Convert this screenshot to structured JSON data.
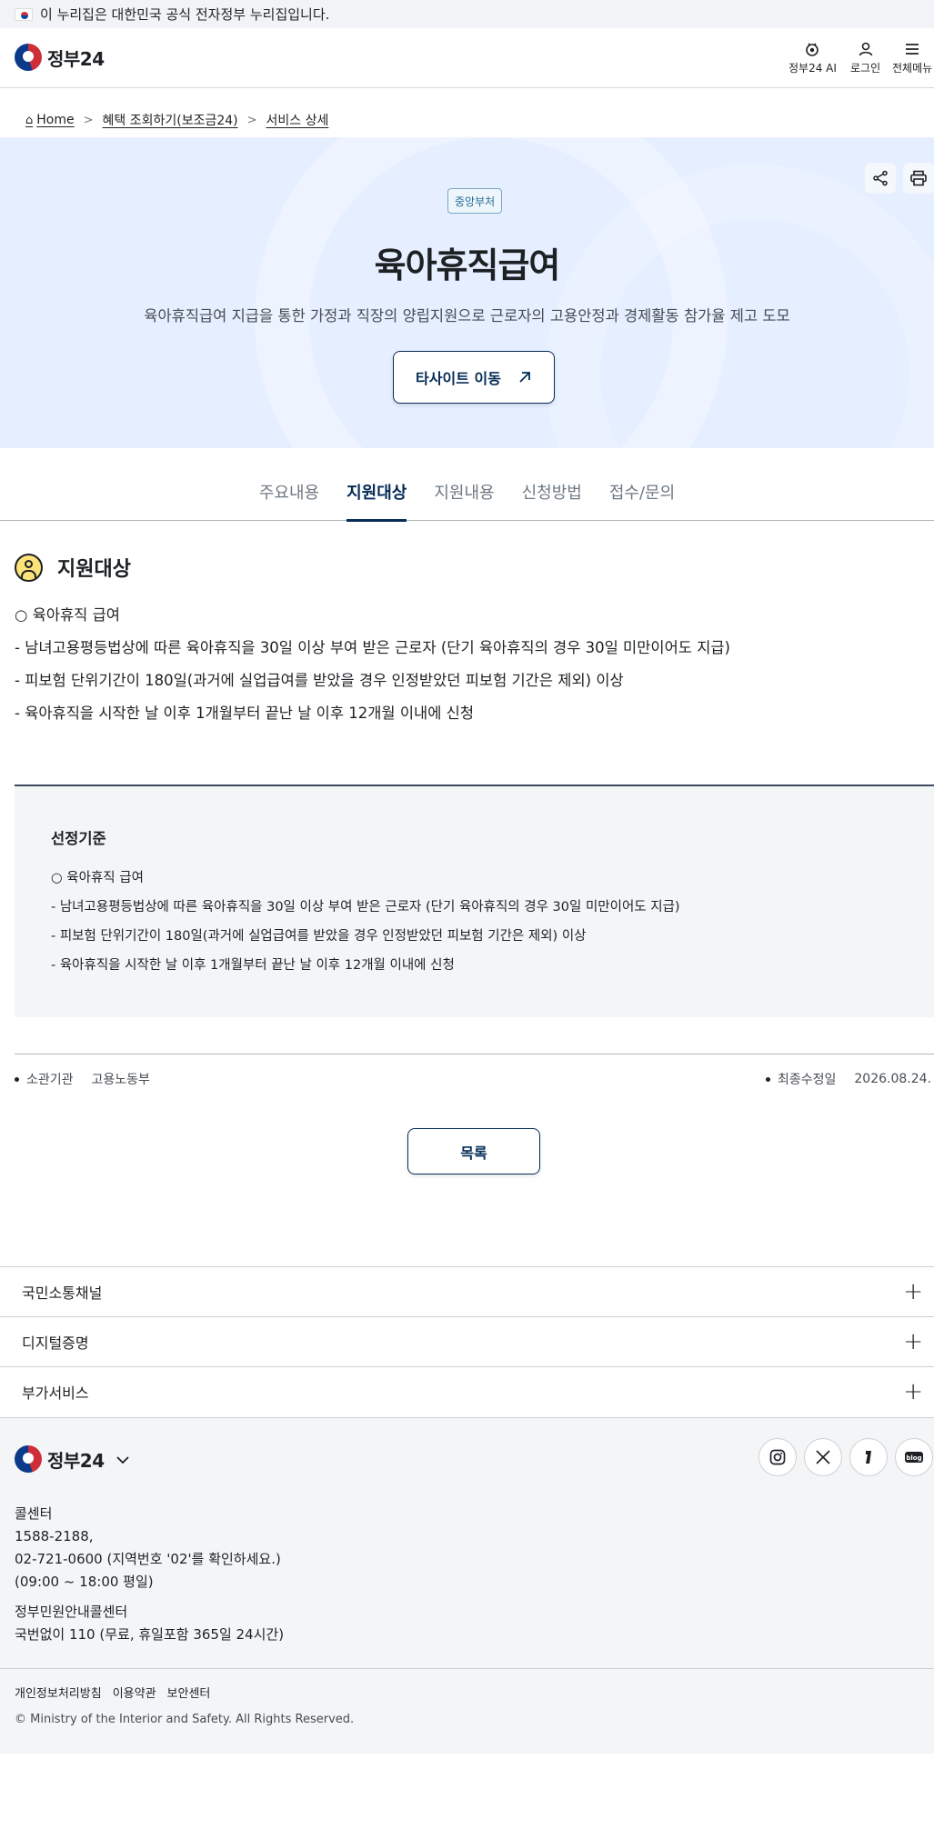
{
  "notice": {
    "text": "이 누리집은 대한민국 공식 전자정부 누리집입니다."
  },
  "header": {
    "logo_text": "정부24",
    "ai_label": "정부24 AI",
    "login_label": "로그인",
    "menu_label": "전체메뉴"
  },
  "breadcrumb": [
    "Home",
    "혜택 조회하기(보조금24)",
    "서비스 상세"
  ],
  "hero": {
    "badge": "중앙부처",
    "title": "육아휴직급여",
    "description": "육아휴직급여 지급을 통한 가정과 직장의 양립지원으로 근로자의 고용안정과 경제활동 참가율 제고 도모",
    "external_button": "타사이트 이동"
  },
  "tabs": [
    {
      "label": "주요내용",
      "active": false
    },
    {
      "label": "지원대상",
      "active": true
    },
    {
      "label": "지원내용",
      "active": false
    },
    {
      "label": "신청방법",
      "active": false
    },
    {
      "label": "접수/문의",
      "active": false
    }
  ],
  "section": {
    "title": "지원대상",
    "lines": [
      "○ 육아휴직 급여",
      "- 남녀고용평등법상에 따른 육아휴직을 30일 이상 부여 받은 근로자 (단기 육아휴직의 경우 30일 미만이어도 지급)",
      "- 피보험 단위기간이 180일(과거에 실업급여를 받았을 경우 인정받았던 피보험 기간은 제외) 이상",
      "- 육아휴직을 시작한 날 이후 1개월부터 끝난 날 이후 12개월 이내에 신청"
    ]
  },
  "selection": {
    "title": "선정기준",
    "lines": [
      "○ 육아휴직 급여",
      "- 남녀고용평등법상에 따른 육아휴직을 30일 이상 부여 받은 근로자 (단기 육아휴직의 경우 30일 미만이어도 지급)",
      "- 피보험 단위기간이 180일(과거에 실업급여를 받았을 경우 인정받았던 피보험 기간은 제외) 이상",
      "- 육아휴직을 시작한 날 이후 1개월부터 끝난 날 이후 12개월 이내에 신청"
    ]
  },
  "meta": {
    "agency_label": "소관기관",
    "agency_value": "고용노동부",
    "modified_label": "최종수정일",
    "modified_value": "2026.08.24."
  },
  "list_button": "목록",
  "accordions": [
    "국민소통채널",
    "디지털증명",
    "부가서비스"
  ],
  "footer": {
    "logo_text": "정부24",
    "social": [
      "instagram-icon",
      "x-icon",
      "kakao-icon",
      "blog-icon"
    ],
    "call_center_title": "콜센터",
    "call_center_lines": [
      "1588-2188,",
      "02-721-0600 (지역번호 '02'를 확인하세요.)",
      "(09:00 ~ 18:00 평일)"
    ],
    "gov_center_title": "정부민원안내콜센터",
    "gov_center_line": "국번없이 110 (무료, 휴일포함 365일 24시간)",
    "links": [
      "개인정보처리방침",
      "이용약관",
      "보안센터"
    ],
    "copyright": "© Ministry of the Interior and Safety. All Rights Reserved."
  },
  "colors": {
    "primary": "#052b57",
    "hero_bg": "#e6efff",
    "badge": "#246a9b"
  }
}
